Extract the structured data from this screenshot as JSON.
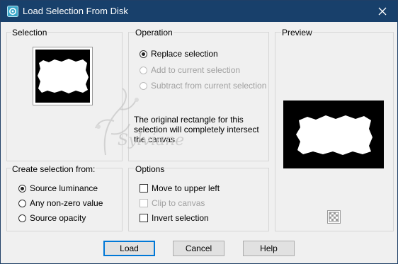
{
  "window": {
    "title": "Load Selection From Disk",
    "close_icon": "close-icon",
    "title_bar_color": "#18406b"
  },
  "selection_group": {
    "label": "Selection"
  },
  "operation_group": {
    "label": "Operation",
    "options": [
      {
        "label": "Replace selection",
        "selected": true,
        "enabled": true
      },
      {
        "label": "Add to current selection",
        "selected": false,
        "enabled": false
      },
      {
        "label": "Subtract from current selection",
        "selected": false,
        "enabled": false
      }
    ],
    "note": "The original rectangle for this selection will completely intersect the canvas."
  },
  "preview_group": {
    "label": "Preview",
    "toggle_icon": "checkerboard-icon"
  },
  "create_from_group": {
    "label": "Create selection from:",
    "options": [
      {
        "label": "Source luminance",
        "selected": true
      },
      {
        "label": "Any non-zero value",
        "selected": false
      },
      {
        "label": "Source opacity",
        "selected": false
      }
    ]
  },
  "options_group": {
    "label": "Options",
    "items": [
      {
        "label": "Move to upper left",
        "checked": false,
        "enabled": true
      },
      {
        "label": "Clip to canvas",
        "checked": false,
        "enabled": false
      },
      {
        "label": "Invert selection",
        "checked": false,
        "enabled": true
      }
    ]
  },
  "buttons": {
    "load": "Load",
    "cancel": "Cancel",
    "help": "Help"
  },
  "watermark": {
    "text": "Sylviane"
  },
  "colors": {
    "accent": "#0078d7",
    "dialog_bg": "#f0f0f0"
  }
}
